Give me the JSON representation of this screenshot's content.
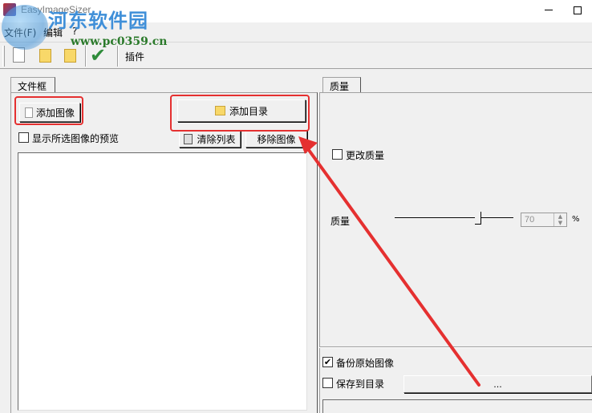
{
  "window": {
    "title": "EasyImageSizer",
    "minimize_glyph": "–",
    "maximize_glyph": "□"
  },
  "watermark": {
    "name": "河东软件园",
    "url": "www.pc0359.cn"
  },
  "menu": {
    "items": [
      "文件(F)",
      "编辑",
      "?"
    ]
  },
  "toolbar": {
    "icons": [
      "new-document-icon",
      "folder-icon",
      "folder-icon",
      "checkmark-icon"
    ],
    "plugin_label": "插件"
  },
  "file_panel": {
    "tab_label": "文件框",
    "add_image_label": "添加图像",
    "add_folder_label": "添加目录",
    "show_preview_label": "显示所选图像的预览",
    "show_preview_checked": false,
    "clear_list_label": "清除列表",
    "remove_image_label": "移除图像",
    "files": []
  },
  "quality_panel": {
    "tab_label": "质量",
    "change_quality_label": "更改质量",
    "change_quality_checked": false,
    "quality_label": "质量",
    "quality_value": "70",
    "quality_unit": "%",
    "backup_label": "备份原始图像",
    "backup_checked": true,
    "save_to_folder_label": "保存到目录",
    "save_to_folder_checked": false,
    "browse_label": "...",
    "destination_path": ""
  },
  "annotations": {
    "highlight_color": "#e53030",
    "arrow_color": "#e53030"
  }
}
